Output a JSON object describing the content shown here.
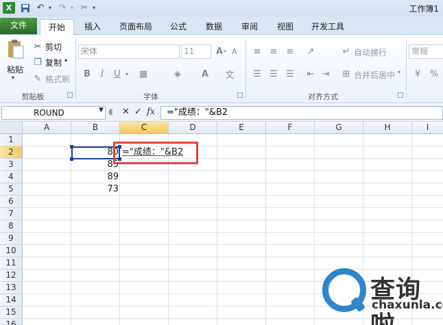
{
  "app": {
    "window_title": "工作簿1"
  },
  "ribbon_tabs": [
    "文件",
    "开始",
    "插入",
    "页面布局",
    "公式",
    "数据",
    "审阅",
    "视图",
    "开发工具"
  ],
  "clipboard": {
    "paste": "粘贴",
    "cut": "剪切",
    "copy": "复制",
    "format_painter": "格式刷",
    "group": "剪贴板"
  },
  "font": {
    "name": "宋体",
    "size": "11",
    "group": "字体"
  },
  "alignment": {
    "wrap": "自动换行",
    "merge": "合并后居中",
    "group": "对齐方式"
  },
  "number": {
    "format": "常规"
  },
  "formula_bar": {
    "name_box": "ROUND",
    "fx": "fx",
    "formula": "=\"成绩：\"&B2"
  },
  "columns": [
    "A",
    "B",
    "C",
    "D",
    "E",
    "F",
    "G",
    "H",
    "I"
  ],
  "rows": [
    "1",
    "2",
    "3",
    "4",
    "5",
    "6",
    "7",
    "8",
    "9",
    "10",
    "11",
    "12",
    "13",
    "14",
    "15",
    "16"
  ],
  "cells": {
    "B2": "80",
    "C2": "=\"成绩：\"&B2",
    "B3": "85",
    "B4": "89",
    "B5": "73"
  },
  "watermark": {
    "text": "查询啦",
    "site": "chaxunla.com"
  },
  "colors": {
    "file_tab": "#2a6b24",
    "selected_header": "#f2c95c",
    "highlight_border": "#d9473f",
    "watermark_blue": "#2f86c9"
  }
}
